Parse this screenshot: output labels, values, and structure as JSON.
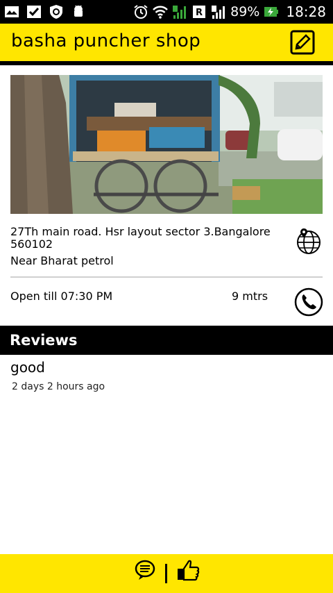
{
  "status_bar": {
    "battery": "89%",
    "time": "18:28",
    "icons": [
      "mail-icon",
      "check-icon",
      "shield-icon",
      "android-icon",
      "alarm-icon",
      "wifi-icon",
      "signal-1-icon",
      "roaming-icon",
      "signal-2-icon",
      "battery-charging-icon"
    ]
  },
  "header": {
    "title": "basha puncher shop",
    "edit_icon": "edit-icon"
  },
  "shop": {
    "address": "27Th main road. Hsr layout sector 3.Bangalore 560102",
    "landmark": "Near Bharat petrol",
    "hours": "Open till 07:30 PM",
    "distance": "9 mtrs",
    "map_icon": "globe-location-icon",
    "phone_icon": "phone-icon"
  },
  "reviews": {
    "title": "Reviews",
    "items": [
      {
        "text": "good",
        "time": "2 days 2 hours ago"
      }
    ]
  },
  "bottom_bar": {
    "chat_icon": "chat-icon",
    "like_icon": "thumbs-up-icon"
  },
  "colors": {
    "accent": "#ffe600",
    "dark": "#000000",
    "background": "#ffffff"
  }
}
